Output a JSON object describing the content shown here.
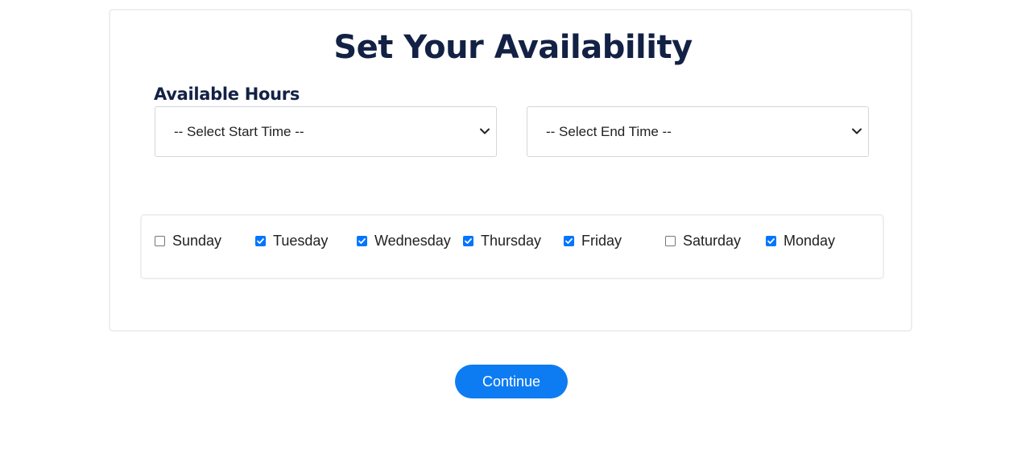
{
  "page": {
    "title": "Set Your Availability",
    "hours_label": "Available Hours"
  },
  "start_time": {
    "selected": "-- Select Start Time --"
  },
  "end_time": {
    "selected": "-- Select End Time --"
  },
  "days": [
    {
      "label": "Sunday",
      "checked": false
    },
    {
      "label": "Tuesday",
      "checked": true
    },
    {
      "label": "Wednesday",
      "checked": true
    },
    {
      "label": "Thursday",
      "checked": true
    },
    {
      "label": "Friday",
      "checked": true
    },
    {
      "label": "Saturday",
      "checked": false
    },
    {
      "label": "Monday",
      "checked": true
    }
  ],
  "continue_button": {
    "label": "Continue"
  },
  "colors": {
    "heading": "#132145",
    "accent": "#0d7cf2",
    "checkbox_checked": "#0075ff"
  }
}
